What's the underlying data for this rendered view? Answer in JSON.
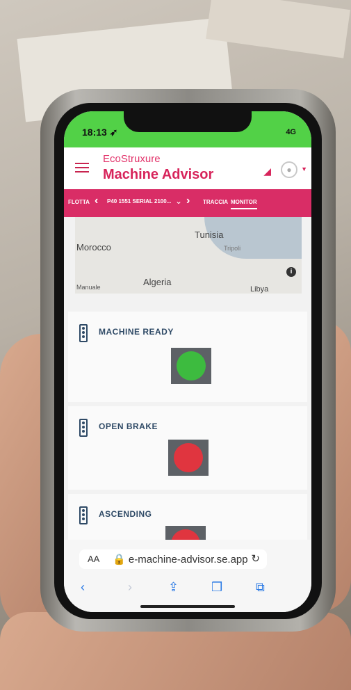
{
  "status": {
    "time": "18:13 ➶",
    "network": "4G"
  },
  "header": {
    "brand_line": "EcoStruxure",
    "app_title": "Machine Advisor"
  },
  "nav": {
    "fleet_label": "FLOTTA",
    "machine_selector": "P40 1551 SERIAL 2100...",
    "tabs": [
      "TRACCIA",
      "MONITOR"
    ],
    "active_tab": "MONITOR"
  },
  "map": {
    "labels": [
      "Tunisia",
      "Tripoli",
      "Morocco",
      "Algeria",
      "Libya"
    ],
    "mode_label": "Manuale"
  },
  "signals": [
    {
      "title": "MACHINE READY",
      "state_color": "#3dbb3f"
    },
    {
      "title": "OPEN BRAKE",
      "state_color": "#e0353f"
    },
    {
      "title": "ASCENDING",
      "state_color": "#e0353f"
    }
  ],
  "browser": {
    "text_size_label": "AA",
    "url": "e-machine-advisor.se.app"
  },
  "icons": [
    "menu-icon",
    "megaphone-icon",
    "user-icon",
    "traffic-light-icon",
    "info-icon",
    "lock-icon",
    "reload-icon",
    "back-icon",
    "forward-icon",
    "share-icon",
    "bookmarks-icon",
    "tabs-icon"
  ]
}
